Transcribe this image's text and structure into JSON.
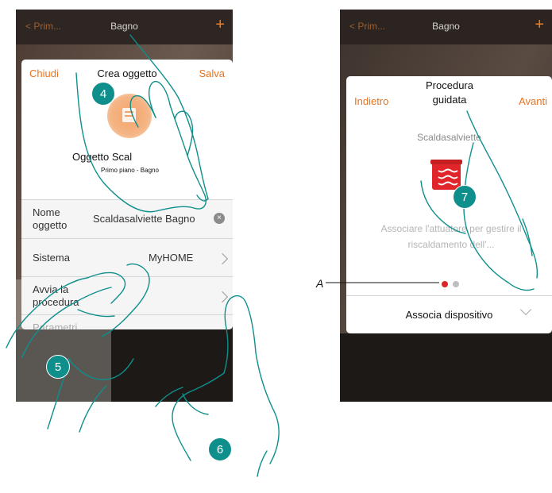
{
  "left_screen": {
    "topbar": {
      "back_label": "Prim...",
      "title": "Bagno",
      "plus": "+"
    },
    "dialog": {
      "close_label": "Chiudi",
      "title": "Crea oggetto",
      "save_label": "Salva",
      "object_name": "Oggetto Scal",
      "object_location": "Primo piano - Bagno"
    },
    "rows": {
      "name_label": "Nome oggetto",
      "name_value": "Scaldasalviette Bagno",
      "system_label": "Sistema",
      "system_value": "MyHOME",
      "procedure_label": "Avvia la procedura",
      "params_label": "Parametri aggiuntivi"
    }
  },
  "right_screen": {
    "topbar": {
      "back_label": "< Prim...",
      "title": "Bagno",
      "plus": "+"
    },
    "dialog": {
      "back_label": "Indietro",
      "title": "Procedura guidata",
      "next_label": "Avanti",
      "device_name": "Scaldasalviette",
      "description": "Associare l'attuatore per gestire il riscaldamento dell'...",
      "associate_label": "Associa dispositivo"
    }
  },
  "callouts": {
    "step4": "4",
    "step5": "5",
    "step6": "6",
    "step7": "7",
    "label_a": "A"
  },
  "colors": {
    "accent": "#e8731f",
    "badge": "#0f8f8c",
    "dot_active": "#d9262b",
    "dot_inactive": "#bfbfbf",
    "device_icon": "#e0262b"
  },
  "icons": {
    "left_object": "towel-heater-icon",
    "right_object": "towel-heater-icon"
  },
  "pagination": {
    "current": 1,
    "total": 2
  }
}
